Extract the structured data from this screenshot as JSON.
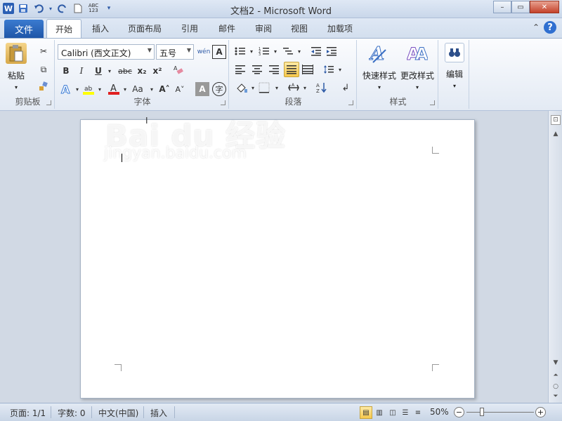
{
  "title": "文档2 - Microsoft Word",
  "quick_access": {
    "word_icon": "W",
    "save": "save-icon",
    "undo": "undo-icon",
    "redo": "redo-icon",
    "new": "new-doc-icon",
    "spelling": "spelling-icon"
  },
  "window_controls": {
    "minimize": "–",
    "restore": "▭",
    "close": "✕"
  },
  "tabs": {
    "file": "文件",
    "home": "开始",
    "insert": "插入",
    "layout": "页面布局",
    "references": "引用",
    "mailings": "邮件",
    "review": "审阅",
    "view": "视图",
    "addins": "加载项"
  },
  "ribbon": {
    "clipboard": {
      "paste": "粘贴",
      "group": "剪贴板"
    },
    "font": {
      "font_name": "Calibri (西文正文)",
      "font_size": "五号",
      "bold": "B",
      "italic": "I",
      "underline": "U",
      "strike": "abc",
      "subscript": "x₂",
      "superscript": "x²",
      "grow": "A˄",
      "shrink": "A˅",
      "change_case": "Aa",
      "group": "字体"
    },
    "paragraph": {
      "group": "段落"
    },
    "styles": {
      "quick_styles": "快速样式",
      "change_styles": "更改样式",
      "group": "样式"
    },
    "editing": {
      "label": "编辑"
    }
  },
  "document": {
    "watermark": "Bai du 经验",
    "watermark_url": "jingyan.baidu.com"
  },
  "status": {
    "page": "页面: 1/1",
    "words": "字数: 0",
    "language": "中文(中国)",
    "insert_mode": "插入",
    "zoom": "50%",
    "zoom_level": 0.5
  },
  "colors": {
    "file_tab": "#2b63bc",
    "highlight": "#f7c94d",
    "font_color_red": "#e02020",
    "highlight_yellow": "#ffff00"
  }
}
